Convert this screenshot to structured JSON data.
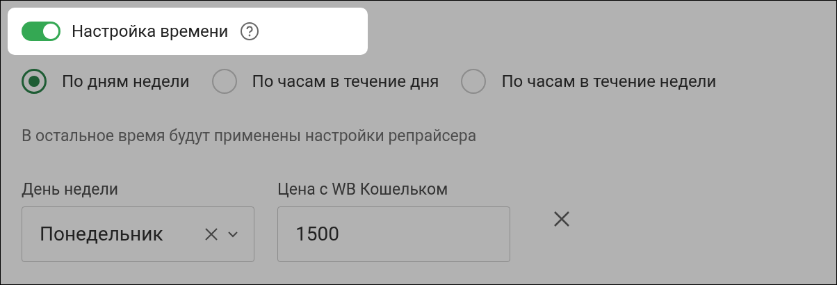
{
  "time_setting": {
    "on": true,
    "label": "Настройка времени"
  },
  "modes": [
    {
      "label": "По дням недели",
      "selected": true
    },
    {
      "label": "По часам в течение дня",
      "selected": false
    },
    {
      "label": "По часам в течение недели",
      "selected": false
    }
  ],
  "hint": "В остальное время будут применены настройки репрайсера",
  "day_field": {
    "label": "День недели",
    "value": "Понедельник"
  },
  "price_field": {
    "label": "Цена с WB Кошельком",
    "value": "1500"
  }
}
